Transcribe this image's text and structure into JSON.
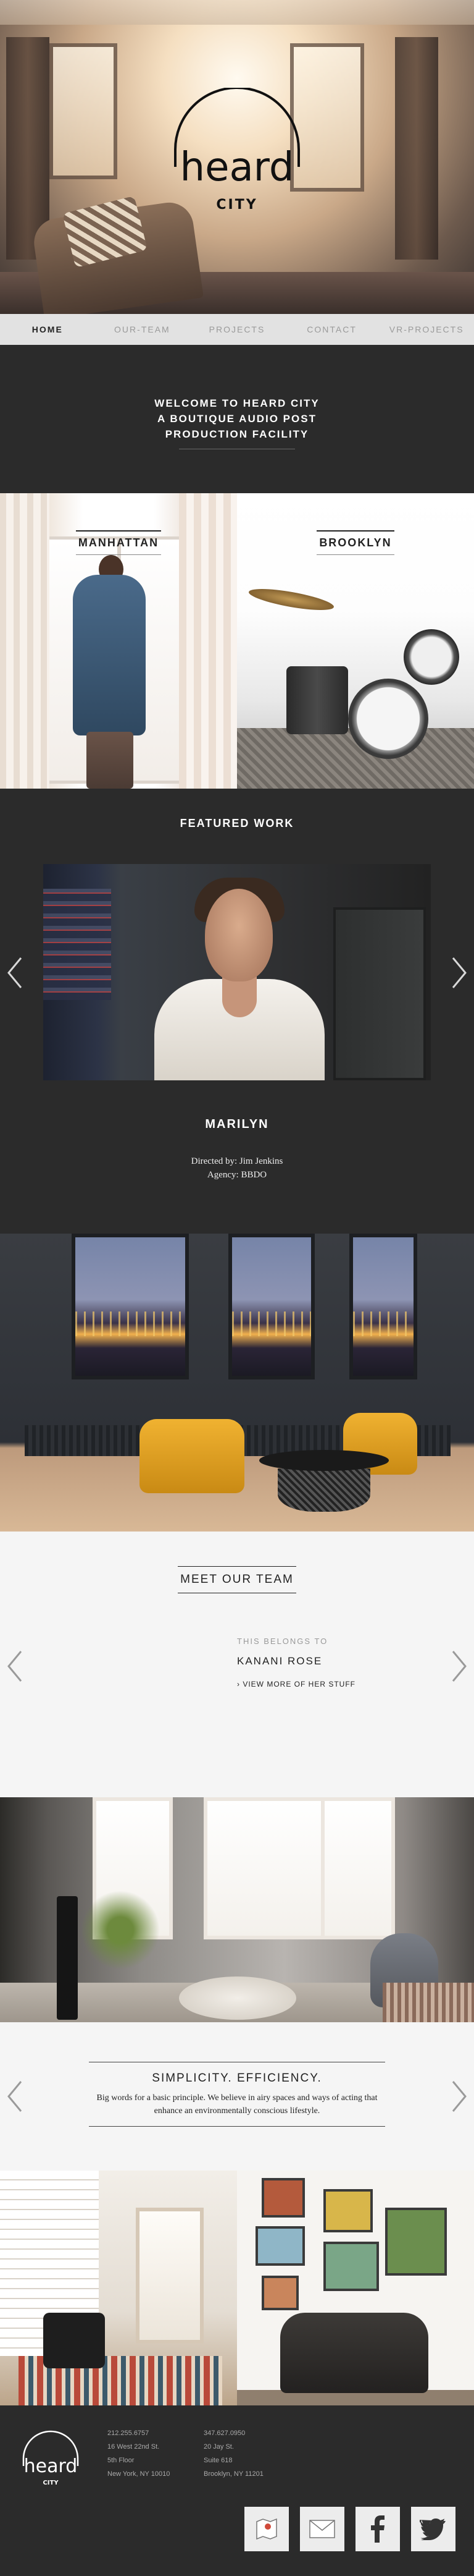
{
  "brand": {
    "logo_word": "heard",
    "logo_sub": "CITY"
  },
  "nav": {
    "items": [
      "HOME",
      "OUR-TEAM",
      "PROJECTS",
      "CONTACT",
      "VR-PROJECTS"
    ],
    "active_index": 0
  },
  "welcome": {
    "text": "WELCOME TO HEARD CITY\nA BOUTIQUE AUDIO POST\nPRODUCTION FACILITY"
  },
  "locations": {
    "manhattan": "MANHATTAN",
    "brooklyn": "BROOKLYN"
  },
  "featured": {
    "heading": "FEATURED WORK",
    "title": "MARILYN",
    "director": "Directed by: Jim Jenkins",
    "agency": "Agency: BBDO"
  },
  "team": {
    "heading": "MEET OUR TEAM",
    "belongs": "THIS BELONGS TO",
    "name": "KANANI ROSE",
    "more": "VIEW MORE OF HER STUFF"
  },
  "simplicity": {
    "heading": "SIMPLICITY. EFFICIENCY.",
    "body": "Big words for a basic principle. We believe in airy spaces and ways of acting that enhance an environmentally conscious lifestyle."
  },
  "footer": {
    "manhattan": "212.255.6757\n16 West 22nd St.\n5th Floor\nNew York, NY 10010",
    "brooklyn": "347.627.0950\n20 Jay St.\nSuite 618\nBrooklyn, NY 11201"
  },
  "icons": {
    "prev": "chevron-left-icon",
    "next": "chevron-right-icon",
    "map": "map-icon",
    "mail": "mail-icon",
    "facebook": "facebook-icon",
    "twitter": "twitter-icon"
  },
  "colors": {
    "dark": "#2b2b2b",
    "nav_bg": "#e2e2e2",
    "light": "#f5f5f5"
  }
}
